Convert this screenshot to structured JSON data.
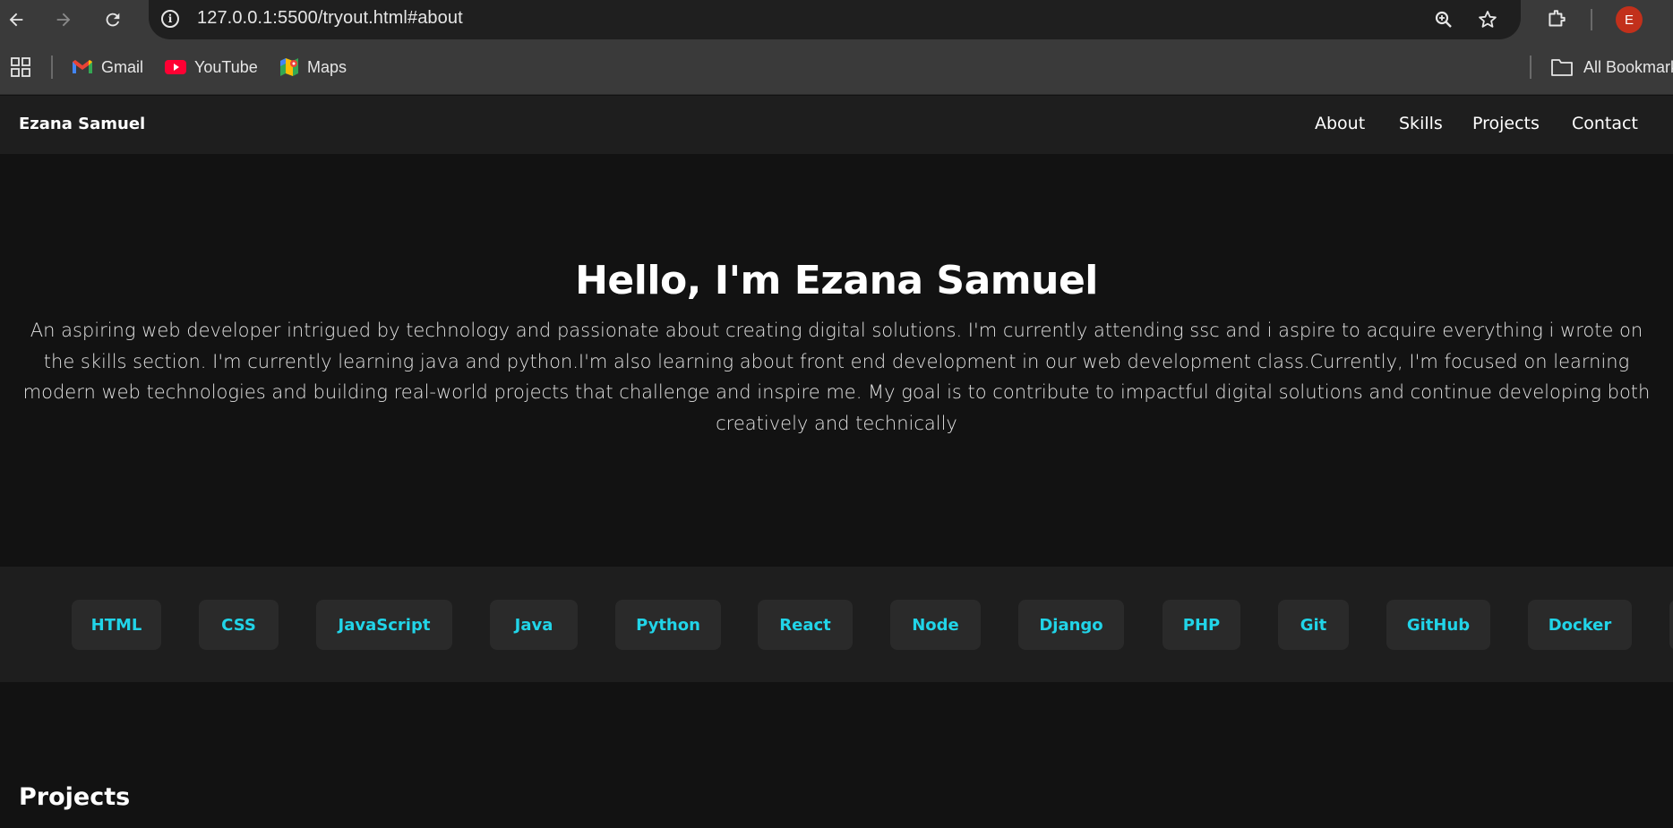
{
  "browser": {
    "url": "127.0.0.1:5500/tryout.html#about",
    "profile_initial": "E",
    "bookmarks": [
      {
        "label": "Gmail",
        "icon": "gmail-icon"
      },
      {
        "label": "YouTube",
        "icon": "youtube-icon"
      },
      {
        "label": "Maps",
        "icon": "maps-icon"
      }
    ],
    "all_bookmarks_label": "All Bookmarks",
    "colors": {
      "avatar": "#c2301b"
    }
  },
  "site": {
    "brand": "Ezana Samuel",
    "nav": [
      "About",
      "Skills",
      "Projects",
      "Contact"
    ]
  },
  "hero": {
    "title": "Hello, I'm Ezana Samuel",
    "bio": "An aspiring web developer intrigued by technology and passionate about creating digital solutions. I'm currently attending ssc and i aspire to acquire everything i wrote on the skills section. I'm currently learning java and python.I'm also learning about front end development in our web development class.Currently, I'm focused on learning modern web technologies and building real-world projects that challenge and inspire me. My goal is to contribute to impactful digital solutions and continue developing both creatively and technically"
  },
  "skills": [
    "HTML",
    "CSS",
    "JavaScript",
    "Java",
    "Python",
    "React",
    "Node",
    "Django",
    "PHP",
    "Git",
    "GitHub",
    "Docker"
  ],
  "projects": {
    "heading": "Projects"
  },
  "theme": {
    "accent": "#21d4e8",
    "background": "#121212",
    "surface": "#1e1e1e",
    "chip": "#2a2a2a"
  }
}
